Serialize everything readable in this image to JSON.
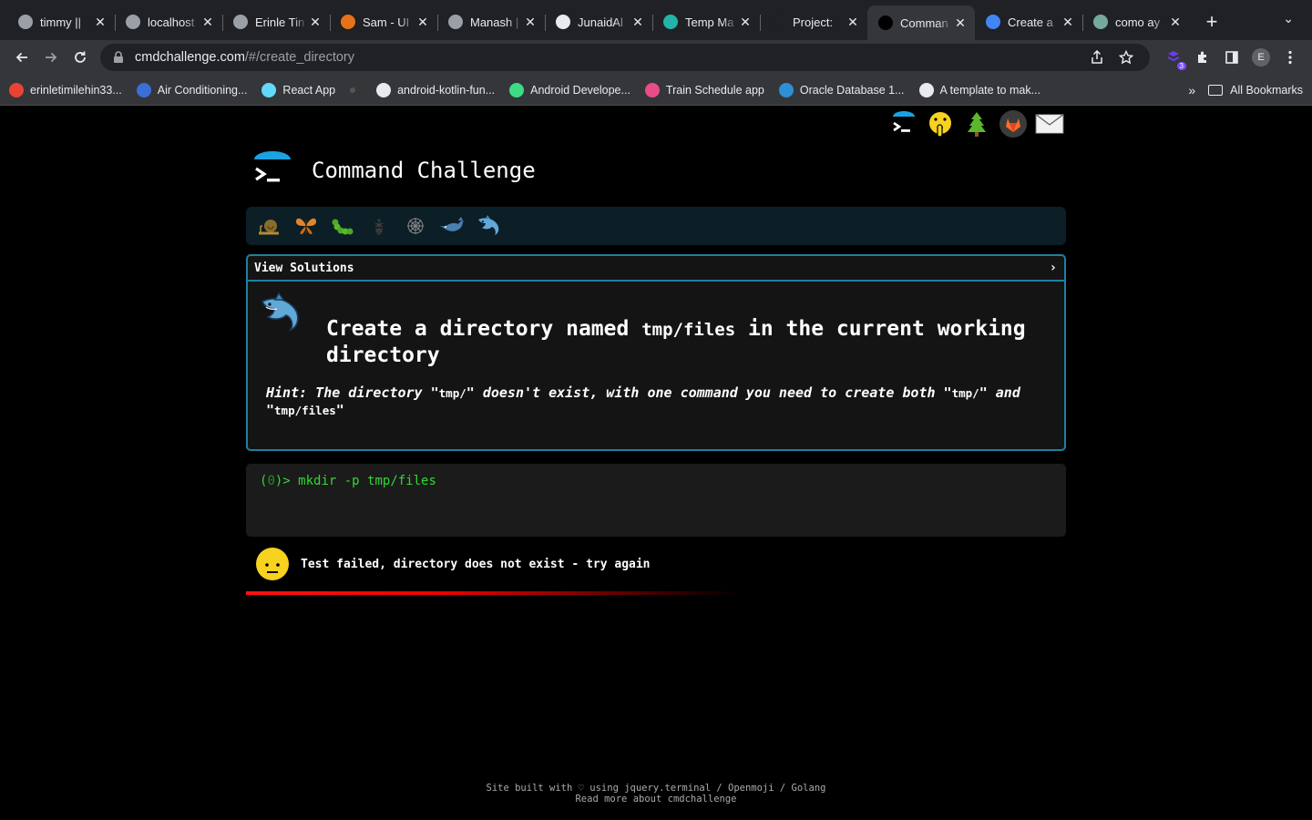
{
  "browser": {
    "tabs": [
      {
        "title": "timmy || ",
        "fav_color": "#9aa0a6",
        "active": false
      },
      {
        "title": "localhost",
        "fav_color": "#9aa0a6",
        "active": false
      },
      {
        "title": "Erinle Tin",
        "fav_color": "#9aa0a6",
        "active": false
      },
      {
        "title": "Sam - UI",
        "fav_color": "#e8711a",
        "active": false
      },
      {
        "title": "Manash |",
        "fav_color": "#9aa0a6",
        "active": false
      },
      {
        "title": "JunaidAl",
        "fav_color": "#e8eaed",
        "active": false
      },
      {
        "title": "Temp Ma",
        "fav_color": "#24b3a8",
        "active": false
      },
      {
        "title": "Project: ",
        "fav_color": "#202124",
        "active": false
      },
      {
        "title": "Comman",
        "fav_color": "#000000",
        "active": true
      },
      {
        "title": "Create a",
        "fav_color": "#4285f4",
        "active": false
      },
      {
        "title": "como ay",
        "fav_color": "#74aa9c",
        "active": false
      }
    ],
    "new_tab": "+",
    "tab_menu": "⌄",
    "url_host": "cmdchallenge.com",
    "url_path": "/#/create_directory",
    "extension_badge": "3",
    "avatar_letter": "E",
    "bookmarks": [
      {
        "label": "erinletimilehin33...",
        "color": "#ea4335"
      },
      {
        "label": "Air Conditioning...",
        "color": "#3a6fd8"
      },
      {
        "label": "React App",
        "color": "#61dafb"
      },
      {
        "label": "",
        "color": "#555555"
      },
      {
        "label": "android-kotlin-fun...",
        "color": "#e8eaed"
      },
      {
        "label": "Android Develope...",
        "color": "#3ddc84"
      },
      {
        "label": "Train Schedule app",
        "color": "#ea4c89"
      },
      {
        "label": "Oracle Database 1...",
        "color": "#2d8fd6"
      },
      {
        "label": "A template to mak...",
        "color": "#e8eaed"
      }
    ],
    "bookmarks_more": "»",
    "all_bookmarks": "All Bookmarks"
  },
  "page": {
    "site_title": "Command Challenge",
    "task_panel_header": "View Solutions",
    "task_title_pre": "Create a directory named ",
    "task_title_code": "tmp/files",
    "task_title_post": " in the current working directory",
    "hint_1": "Hint: The directory \"",
    "hint_code_1": "tmp/",
    "hint_2": "\" doesn't exist, with one command you need to create both \"",
    "hint_code_2": "tmp/",
    "hint_3": "\" and \"",
    "hint_code_3": "tmp/files",
    "hint_4": "\"",
    "prompt_open": "(",
    "prompt_code": "0",
    "prompt_close": ")> ",
    "command": "mkdir -p tmp/files",
    "result_message": "Test failed, directory does not exist - try again",
    "progress_fraction": 0.6,
    "footer_line1": "Site built with ♡ using jquery.terminal / Openmoji / Golang",
    "footer_line2": "Read more about cmdchallenge"
  },
  "icons": {
    "top": [
      "terminal-icon",
      "shushing-face-icon",
      "tree-icon",
      "gitlab-icon",
      "envelope-icon"
    ],
    "levels": [
      "snail-icon",
      "butterfly-icon",
      "caterpillar-icon",
      "ant-icon",
      "spider-web-icon",
      "whale-icon",
      "dolphin-icon"
    ]
  },
  "colors": {
    "accent_border": "#1f7fa0",
    "terminal_text": "#32d832",
    "fail_bar": "#ee0000"
  }
}
